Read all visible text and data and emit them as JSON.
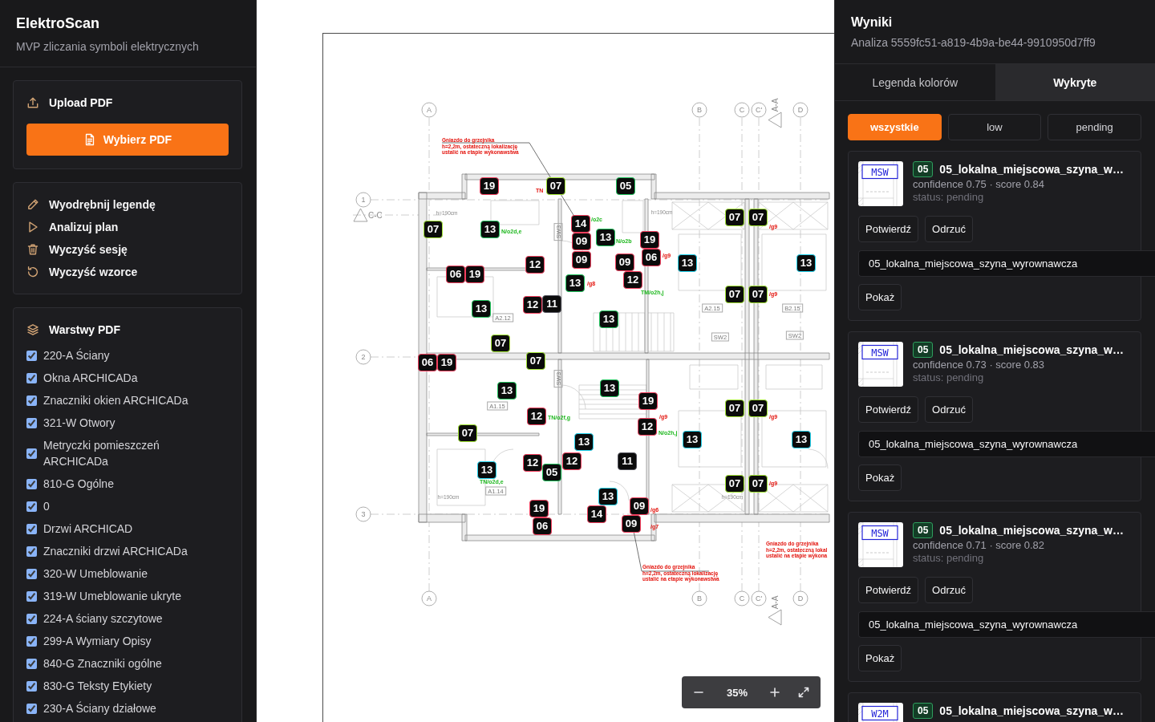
{
  "sidebar": {
    "title": "ElektroScan",
    "subtitle": "MVP zliczania symboli elektrycznych",
    "upload": {
      "heading": "Upload PDF",
      "button": "Wybierz PDF"
    },
    "actions": [
      "Wyodrębnij legendę",
      "Analizuj plan",
      "Wyczyść sesję",
      "Wyczyść wzorce"
    ],
    "layers": {
      "heading": "Warstwy PDF",
      "items": [
        {
          "label": "220-A Ściany",
          "checked": true
        },
        {
          "label": "Okna ARCHICADa",
          "checked": true
        },
        {
          "label": "Znaczniki okien ARCHICADa",
          "checked": true
        },
        {
          "label": "321-W Otwory",
          "checked": true
        },
        {
          "label": "Metryczki pomieszczeń ARCHICADa",
          "checked": true
        },
        {
          "label": "810-G Ogólne",
          "checked": true
        },
        {
          "label": "0",
          "checked": true
        },
        {
          "label": "Drzwi ARCHICAD",
          "checked": true
        },
        {
          "label": "Znaczniki drzwi ARCHICADa",
          "checked": true
        },
        {
          "label": "320-W Umeblowanie",
          "checked": true
        },
        {
          "label": "319-W Umeblowanie ukryte",
          "checked": true
        },
        {
          "label": "224-A ściany szczytowe",
          "checked": true
        },
        {
          "label": "299-A Wymiary Opisy",
          "checked": true
        },
        {
          "label": "840-G Znaczniki ogólne",
          "checked": true
        },
        {
          "label": "830-G Teksty Etykiety",
          "checked": true
        },
        {
          "label": "230-A Ściany działowe",
          "checked": true
        }
      ]
    }
  },
  "viewer": {
    "plan": {
      "grid_labels": [
        "A",
        "B",
        "C",
        "C'",
        "D",
        "A",
        "B",
        "C",
        "C'",
        "D",
        "1",
        "2",
        "3"
      ],
      "section_labels": [
        "C-C",
        "A-A",
        "A-A"
      ],
      "notes": [
        "Gniazdo do grzejnika\nh=2,2m, ostateczną lokalizację\nustalić na etapie wykonawstwa",
        "Gniazdo do grzejnika\nh=2,2m, ostateczną lokalizację\nustalić na etapie wykonawstwa",
        "Gniazdo do grzejnika\nh=2,2m, ostateczną lokal\nustalić na etapie wykona"
      ],
      "room_labels": [
        "A2.12",
        "A2.15",
        "B2.15",
        "A1.15",
        "A1.14",
        "SW2",
        "SW2"
      ],
      "vertical_labels": [
        "SW3",
        "SW3"
      ],
      "height_notes": [
        "h=190cm",
        "h=190cm",
        "h=190cm",
        "h=190cm"
      ],
      "socket_tags": [
        "N/o2d,e",
        "/o2c",
        "N/o2b",
        "TM/o2h,j",
        "TN/o2f,g",
        "N/o2h,j",
        "TN/o2d,e"
      ],
      "circuit_tags": [
        "TN",
        "/g9",
        "/g9",
        "/g8",
        "/g9",
        "/g9",
        "/g9",
        "/g9",
        "/g6",
        "/g7"
      ],
      "markers": [
        {
          "text": "19",
          "color": "#f43f5e"
        },
        {
          "text": "07",
          "color": "#a3e635"
        },
        {
          "text": "05",
          "color": "#22c55e"
        },
        {
          "text": "07",
          "color": "#a3e635"
        },
        {
          "text": "07",
          "color": "#a3e635"
        },
        {
          "text": "07",
          "color": "#a3e635"
        },
        {
          "text": "13",
          "color": "#22c55e"
        },
        {
          "text": "14",
          "color": "#f43f5e"
        },
        {
          "text": "09",
          "color": "#f43f5e"
        },
        {
          "text": "13",
          "color": "#22c55e"
        },
        {
          "text": "19",
          "color": "#f43f5e"
        },
        {
          "text": "12",
          "color": "#f43f5e"
        },
        {
          "text": "09",
          "color": "#f43f5e"
        },
        {
          "text": "09",
          "color": "#f43f5e"
        },
        {
          "text": "06",
          "color": "#f43f5e"
        },
        {
          "text": "13",
          "color": "#22d3ee"
        },
        {
          "text": "13",
          "color": "#22d3ee"
        },
        {
          "text": "06",
          "color": "#f43f5e"
        },
        {
          "text": "19",
          "color": "#f43f5e"
        },
        {
          "text": "13",
          "color": "#22c55e"
        },
        {
          "text": "12",
          "color": "#f43f5e"
        },
        {
          "text": "07",
          "color": "#a3e635"
        },
        {
          "text": "07",
          "color": "#a3e635"
        },
        {
          "text": "13",
          "color": "#22c55e"
        },
        {
          "text": "12",
          "color": "#f43f5e"
        },
        {
          "text": "11",
          "color": "#52525b"
        },
        {
          "text": "13",
          "color": "#22c55e"
        },
        {
          "text": "07",
          "color": "#a3e635"
        },
        {
          "text": "06",
          "color": "#f43f5e"
        },
        {
          "text": "19",
          "color": "#f43f5e"
        },
        {
          "text": "07",
          "color": "#a3e635"
        },
        {
          "text": "13",
          "color": "#22c55e"
        },
        {
          "text": "13",
          "color": "#22c55e"
        },
        {
          "text": "19",
          "color": "#f43f5e"
        },
        {
          "text": "07",
          "color": "#a3e635"
        },
        {
          "text": "07",
          "color": "#a3e635"
        },
        {
          "text": "12",
          "color": "#f43f5e"
        },
        {
          "text": "07",
          "color": "#a3e635"
        },
        {
          "text": "12",
          "color": "#f43f5e"
        },
        {
          "text": "13",
          "color": "#22d3ee"
        },
        {
          "text": "13",
          "color": "#22d3ee"
        },
        {
          "text": "13",
          "color": "#22d3ee"
        },
        {
          "text": "13",
          "color": "#22d3ee"
        },
        {
          "text": "12",
          "color": "#f43f5e"
        },
        {
          "text": "05",
          "color": "#22c55e"
        },
        {
          "text": "12",
          "color": "#f43f5e"
        },
        {
          "text": "11",
          "color": "#52525b"
        },
        {
          "text": "07",
          "color": "#a3e635"
        },
        {
          "text": "07",
          "color": "#a3e635"
        },
        {
          "text": "13",
          "color": "#22d3ee"
        },
        {
          "text": "19",
          "color": "#f43f5e"
        },
        {
          "text": "14",
          "color": "#f43f5e"
        },
        {
          "text": "09",
          "color": "#f43f5e"
        },
        {
          "text": "06",
          "color": "#f43f5e"
        },
        {
          "text": "09",
          "color": "#f43f5e"
        }
      ]
    },
    "zoom_label": "35%"
  },
  "results": {
    "title": "Wyniki",
    "subtitle": "Analiza 5559fc51-a819-4b9a-be44-9910950d7ff9",
    "tabs": [
      {
        "label": "Legenda kolorów",
        "selected": false
      },
      {
        "label": "Wykryte",
        "selected": true
      }
    ],
    "filters": [
      {
        "label": "wszystkie",
        "selected": true
      },
      {
        "label": "low",
        "selected": false
      },
      {
        "label": "pending",
        "selected": false
      }
    ],
    "items": [
      {
        "thumb_label": "MSW",
        "badge": "05",
        "title": "05_lokalna_miejscowa_szyna_w…",
        "meta": "confidence 0.75 · score 0.84",
        "status": "status: pending",
        "confirm": "Potwierdź",
        "reject": "Odrzuć",
        "class_value": "05_lokalna_miejscowa_szyna_wyrownawcza",
        "show": "Pokaż"
      },
      {
        "thumb_label": "MSW",
        "badge": "05",
        "title": "05_lokalna_miejscowa_szyna_w…",
        "meta": "confidence 0.73 · score 0.83",
        "status": "status: pending",
        "confirm": "Potwierdź",
        "reject": "Odrzuć",
        "class_value": "05_lokalna_miejscowa_szyna_wyrownawcza",
        "show": "Pokaż"
      },
      {
        "thumb_label": "MSW",
        "badge": "05",
        "title": "05_lokalna_miejscowa_szyna_w…",
        "meta": "confidence 0.71 · score 0.82",
        "status": "status: pending",
        "confirm": "Potwierdź",
        "reject": "Odrzuć",
        "class_value": "05_lokalna_miejscowa_szyna_wyrownawcza",
        "show": "Pokaż"
      },
      {
        "thumb_label": "W2M",
        "badge": "05",
        "title": "05_lokalna_miejscowa_szyna_w…"
      }
    ]
  }
}
